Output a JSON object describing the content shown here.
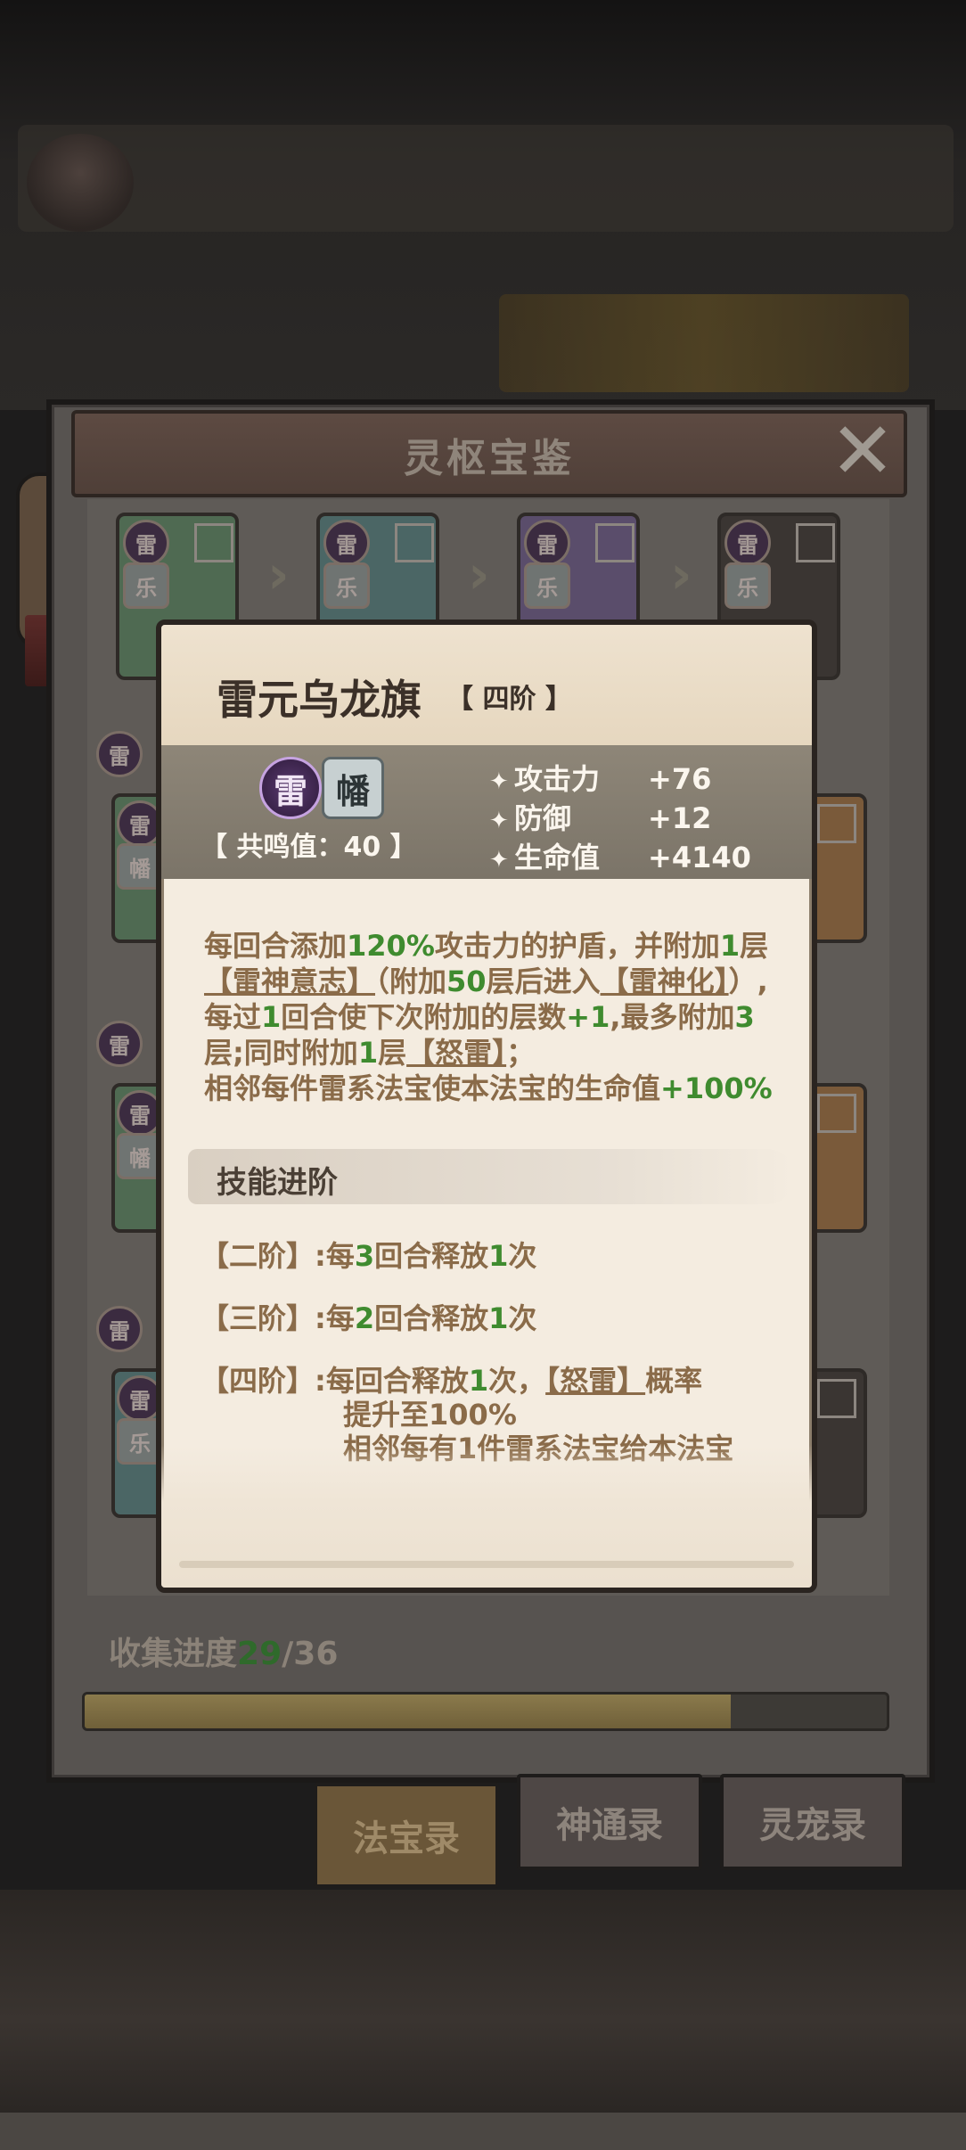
{
  "panel": {
    "title": "灵枢宝鉴",
    "close_icon": "close-icon",
    "card_badges": {
      "thunder": "雷",
      "joy": "乐",
      "banner": "幡"
    },
    "collection": {
      "label": "收集进度",
      "current": "29",
      "sep_total": "/36",
      "progress_fraction": 0.8056
    }
  },
  "tabs": [
    {
      "label": "法宝录",
      "active": true
    },
    {
      "label": "神通录",
      "active": false
    },
    {
      "label": "灵宠录",
      "active": false
    }
  ],
  "popup": {
    "name": "雷元乌龙旗",
    "rank": "【 四阶 】",
    "element_icons": [
      "雷",
      "幡"
    ],
    "resonance": "【 共鸣值：40 】",
    "stats": [
      {
        "label": "攻击力",
        "value": "+76"
      },
      {
        "label": "防御",
        "value": "+12"
      },
      {
        "label": "生命值",
        "value": "+4140"
      }
    ],
    "desc_parts": {
      "p1": "每回合添加",
      "n1": "120%",
      "p2": "攻击力的护盾，并附加",
      "n2": "1",
      "p3": "层",
      "l1": "【雷神意志】",
      "p4": "（附加",
      "n3": "50",
      "p5": "层后进入",
      "l2": "【雷神化】",
      "p6": "）,每过",
      "n4": "1",
      "p7": "回合使下次附加的层数",
      "n5": "+1",
      "p8": ",最多附加",
      "n6": "3",
      "p9": "层;同时附加",
      "n7": "1",
      "p10": "层",
      "l3": "【怒雷】",
      "p11": "；",
      "p12": "相邻每件雷系法宝使本法宝的生命值",
      "n8": "+100%"
    },
    "skill_section_title": "技能进阶",
    "tiers": [
      {
        "label": "【二阶】",
        "pre": ":每",
        "num": "3",
        "post": "回合释放",
        "num2": "1",
        "end": "次"
      },
      {
        "label": "【三阶】",
        "pre": ":每",
        "num": "2",
        "post": "回合释放",
        "num2": "1",
        "end": "次"
      },
      {
        "label": "【四阶】",
        "pre": ":每回合释放",
        "num": "1",
        "post": "次，",
        "link": "【怒雷】",
        "end": "概率"
      }
    ],
    "tier4_line2_pre": "提升至",
    "tier4_line2_num": "100%",
    "tier4_line3_pre": "相邻每有",
    "tier4_line3_num": "1",
    "tier4_line3_post": "件雷系法宝给本法宝"
  }
}
